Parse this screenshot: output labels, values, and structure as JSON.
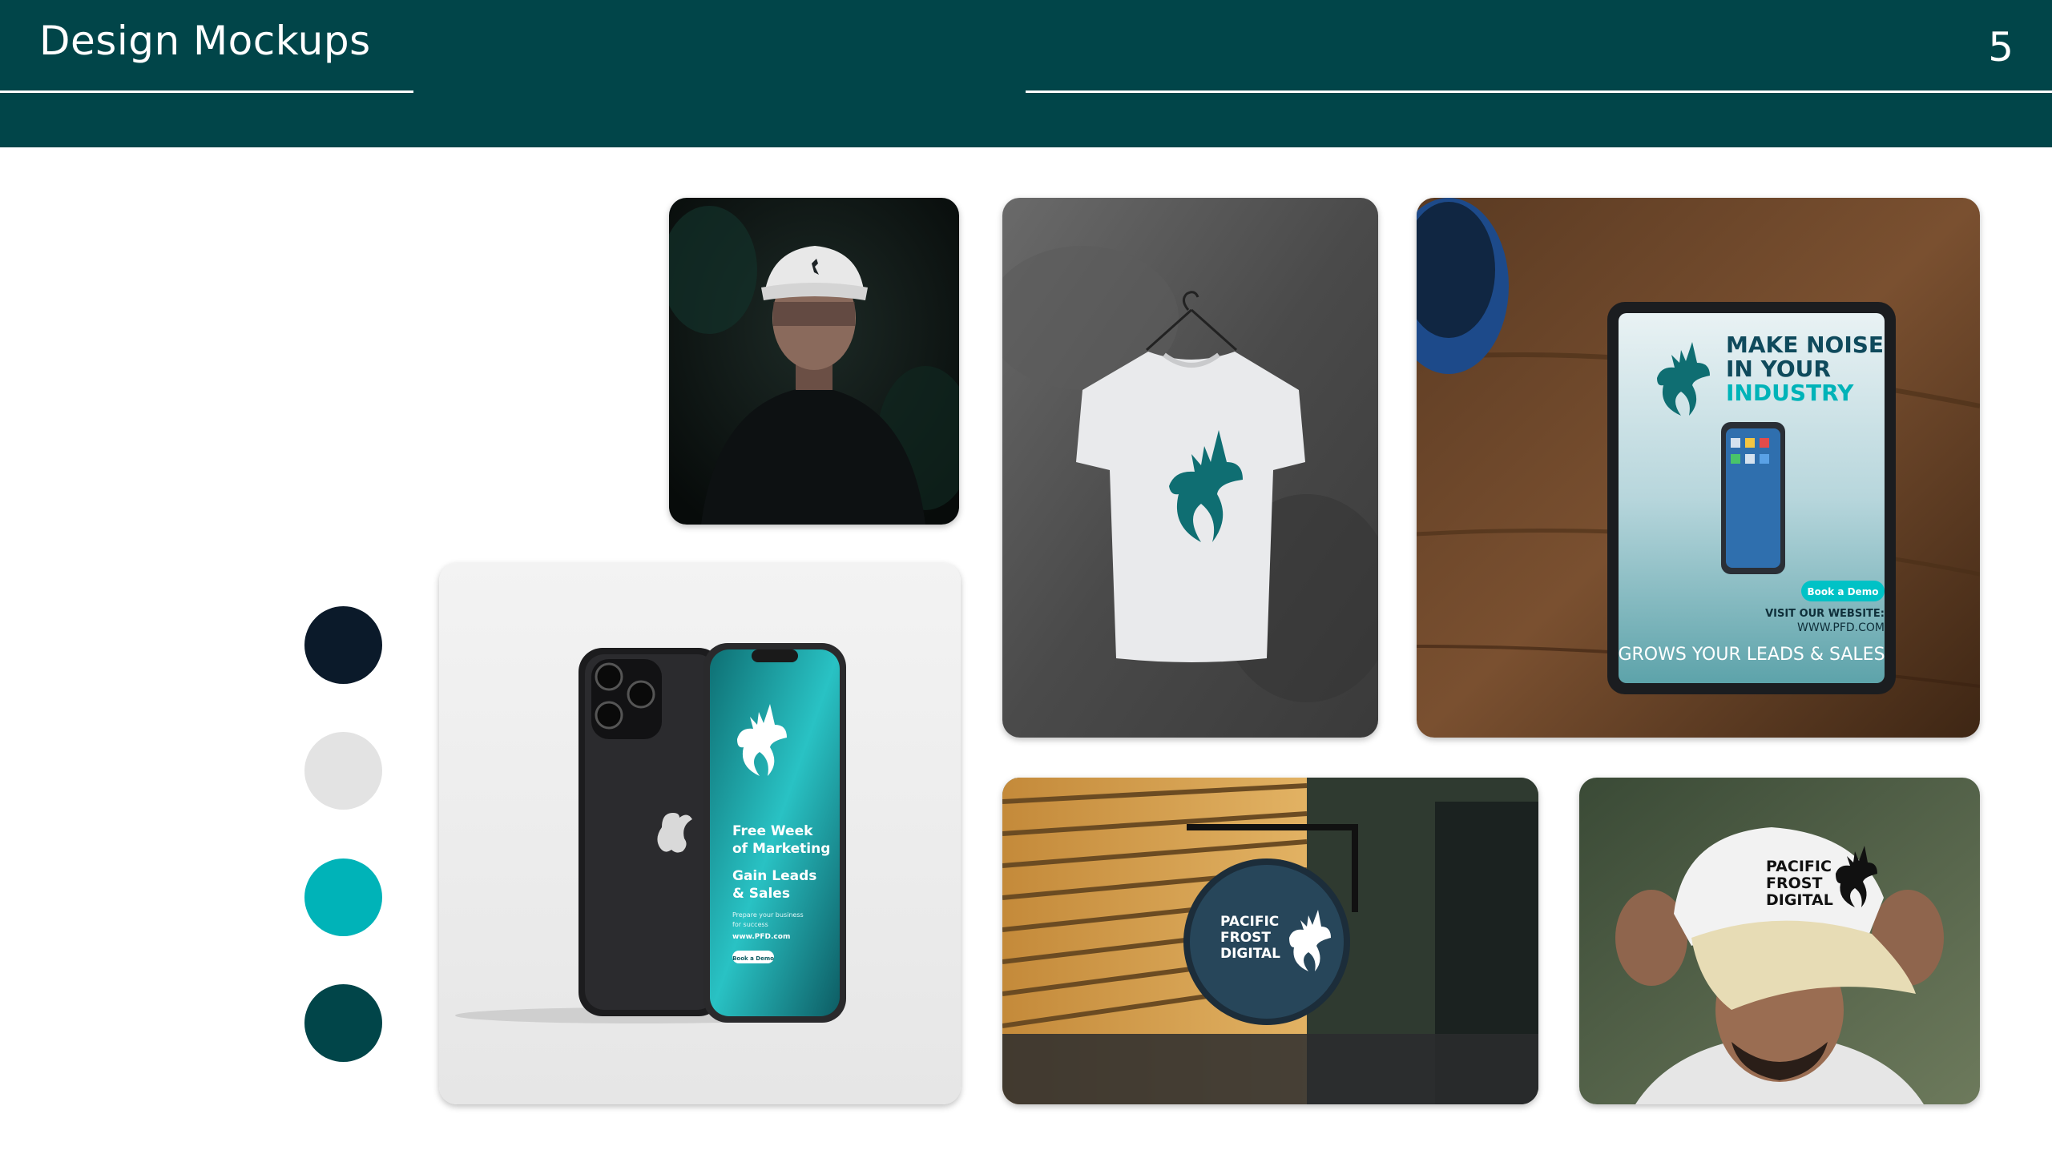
{
  "header": {
    "title": "Design Mockups",
    "page_number": "5"
  },
  "palette": {
    "colors": [
      "#0b1a2a",
      "#e3e3e3",
      "#00b3b8",
      "#014549"
    ]
  },
  "mockups": {
    "tablet_ad": {
      "headline_line1": "MAKE NOISE",
      "headline_line2": "IN YOUR",
      "headline_line3": "INDUSTRY",
      "cta_button": "Book a Demo",
      "visit_label": "VISIT OUR WEBSITE:",
      "url": "WWW.PFD.COM",
      "footer": "GROWS YOUR LEADS & SALES"
    },
    "phone_ad": {
      "line1": "Free Week",
      "line2": "of Marketing",
      "line3": "Gain Leads",
      "line4": "& Sales",
      "small1": "Prepare your business",
      "small2": "for success",
      "url": "www.PFD.com",
      "cta_button": "Book a Demo"
    },
    "sign": {
      "line1": "PACIFIC",
      "line2": "FROST",
      "line3": "DIGITAL"
    },
    "cap": {
      "line1": "PACIFIC",
      "line2": "FROST",
      "line3": "DIGITAL"
    }
  }
}
